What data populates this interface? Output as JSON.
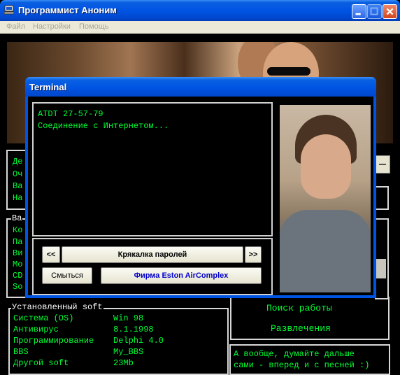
{
  "window": {
    "title": "Программист Аноним"
  },
  "menubar": {
    "items": [
      "Файл",
      "Настройки",
      "Помощь"
    ]
  },
  "panels": {
    "top_left_lines": [
      "Де",
      "Оч",
      "Ва",
      "На"
    ],
    "mid_left_legend": "Ва",
    "mid_left_lines": [
      "Ко",
      "Па",
      "Ви",
      "Мо",
      "CD",
      "So"
    ],
    "installed_soft": {
      "legend": "Установленный soft",
      "rows": [
        {
          "label": "Система (OS)",
          "value": "Win 98"
        },
        {
          "label": "Антивирус",
          "value": "8.1.1998"
        },
        {
          "label": "Программирование",
          "value": "Delphi 4.0"
        },
        {
          "label": "BBS",
          "value": "My_BBS"
        },
        {
          "label": "Другой soft",
          "value": "23Mb"
        }
      ]
    },
    "actions": {
      "job_search": "Поиск работы",
      "entertainment": "Развлечения"
    },
    "hint": {
      "line1": "А вообще, думайте дальше",
      "line2": "сами - вперед и с песней :)"
    }
  },
  "terminal": {
    "title": "Terminal",
    "lines": [
      "ATDT 27-57-79",
      "Соединение с Интернетом..."
    ],
    "prev_label": "<<",
    "next_label": ">>",
    "program_label": "Крякалка паролей",
    "escape_label": "Смыться",
    "company_label": "Фирма Eston AirComplex"
  },
  "colors": {
    "terminal_text": "#00ff33",
    "titlebar_blue": "#0054e3"
  }
}
